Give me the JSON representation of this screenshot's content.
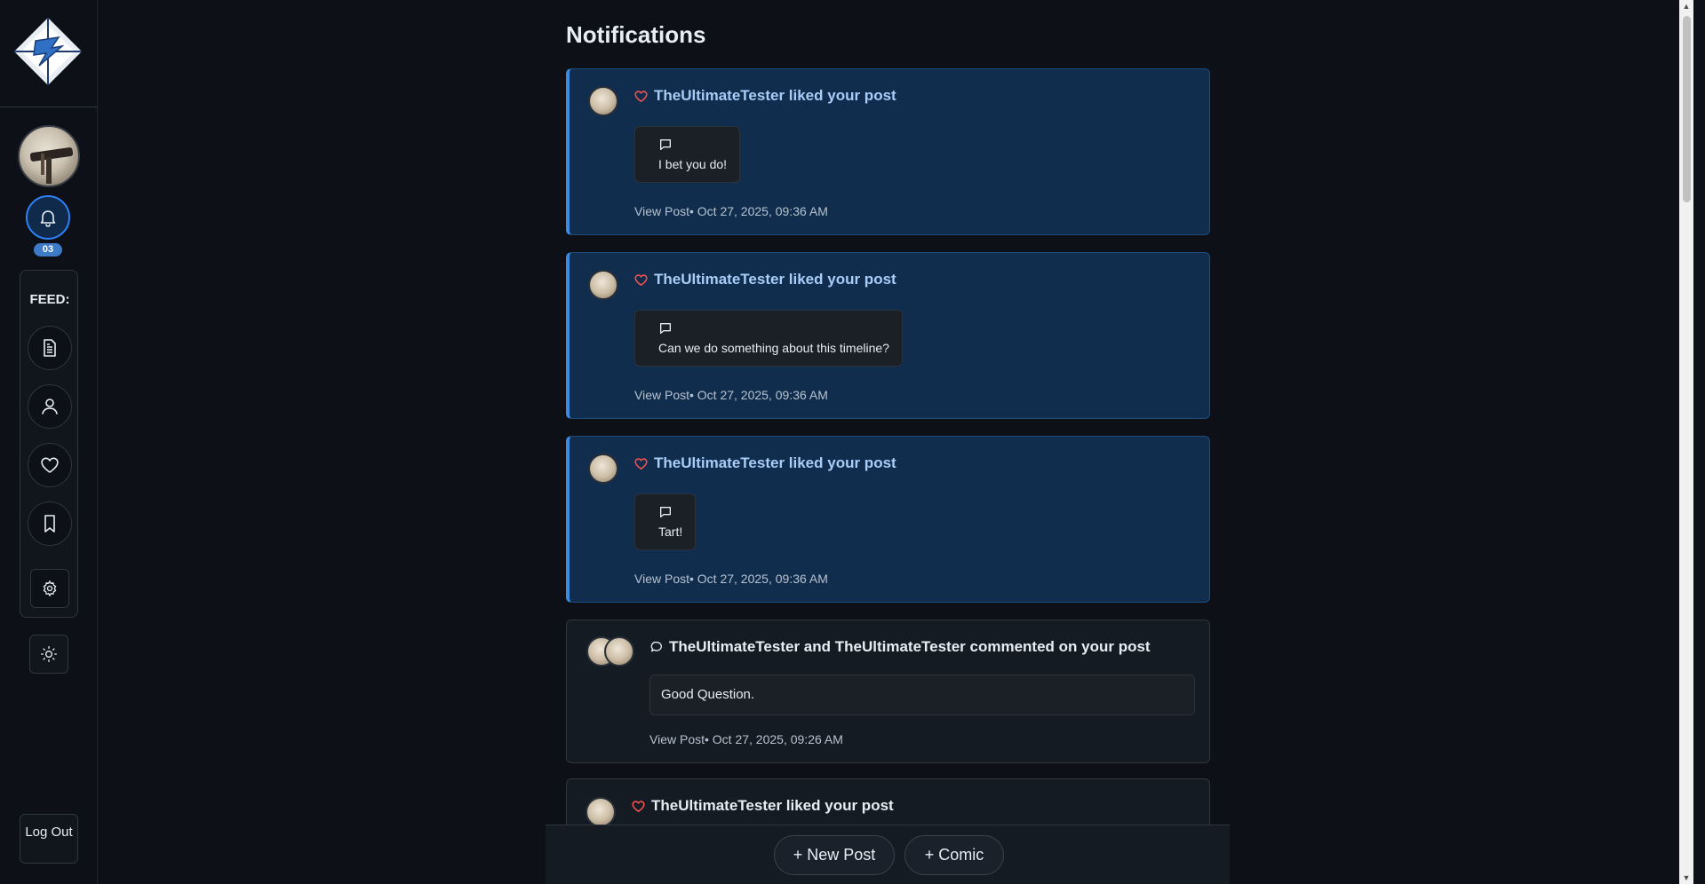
{
  "page": {
    "title": "Notifications"
  },
  "sidebar": {
    "notification_count": "03",
    "feed_label": "FEED:",
    "feed_items": [
      "posts-icon",
      "user-icon",
      "heart-icon",
      "bookmark-icon"
    ],
    "logout_label": "Log Out"
  },
  "notifications": [
    {
      "actor": "TheUltimateTester",
      "action": " liked your post",
      "excerpt": "I bet you do!",
      "view_label": "View Post",
      "time": "• Oct 27, 2025, 09:36 AM",
      "unread": true
    },
    {
      "actor": "TheUltimateTester",
      "action": " liked your post",
      "excerpt": "Can we do something about this timeline?",
      "view_label": "View Post",
      "time": "• Oct 27, 2025, 09:36 AM",
      "unread": true
    },
    {
      "actor": "TheUltimateTester",
      "action": " liked your post",
      "excerpt": "Tart!",
      "view_label": "View Post",
      "time": "• Oct 27, 2025, 09:36 AM",
      "unread": true
    },
    {
      "actor": "TheUltimateTester and TheUltimateTester commented on your post",
      "excerpt": "Good Question.",
      "view_label": "View Post",
      "time": "• Oct 27, 2025, 09:26 AM",
      "unread": false
    },
    {
      "actor": "TheUltimateTester",
      "action": " liked your post",
      "unread": false
    }
  ],
  "bottom_bar": {
    "new_post_label": "+ New Post",
    "comic_label": "+ Comic"
  },
  "colors": {
    "accent": "#3d8ae0",
    "unread_bg": "#112d4e",
    "heart": "#f0524f"
  }
}
